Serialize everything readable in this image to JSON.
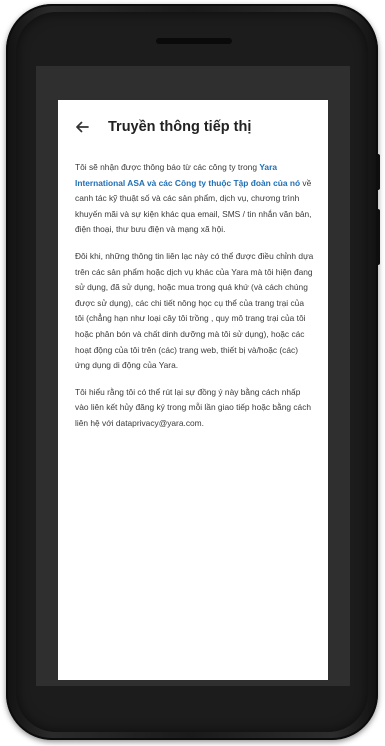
{
  "header": {
    "back_label": "←",
    "title": "Truyền thông tiếp thị"
  },
  "body": {
    "p1_prefix": "Tôi sẽ nhận được thông báo từ các công ty trong ",
    "p1_link": "Yara International ASA và các Công ty thuộc Tập đoàn của nó",
    "p1_suffix": " về canh tác kỹ thuật số và các sản phẩm, dịch vụ, chương trình khuyến mãi và sự kiện khác qua email, SMS / tin nhắn văn bản, điện thoại, thư bưu điện và mạng xã hội.",
    "p2": "Đôi khi, những thông tin liên lạc này có thể được điều chỉnh dựa trên các sản phẩm hoặc dịch vụ khác của Yara mà tôi hiện đang sử dụng, đã sử dụng, hoặc mua trong quá khứ (và cách chúng được sử dụng), các chi tiết nông học cụ thể của trang trại của tôi (chẳng hạn như loại cây tôi trồng , quy mô trang trại của tôi hoặc phân bón và chất dinh dưỡng mà tôi sử dụng), hoặc các hoạt động của tôi trên (các) trang web, thiết bị và/hoặc (các) ứng dụng di động của Yara.",
    "p3": "Tôi hiểu rằng tôi có thể rút lại sự đồng ý này bằng cách nhấp vào liên kết hủy đăng ký trong mỗi lần giao tiếp hoặc bằng cách liên hệ với dataprivacy@yara.com."
  },
  "colors": {
    "link": "#1f6fb5",
    "text": "#3a3a3a",
    "device": "#1c1c1c"
  },
  "icons": {
    "back": "arrow-left-icon"
  }
}
